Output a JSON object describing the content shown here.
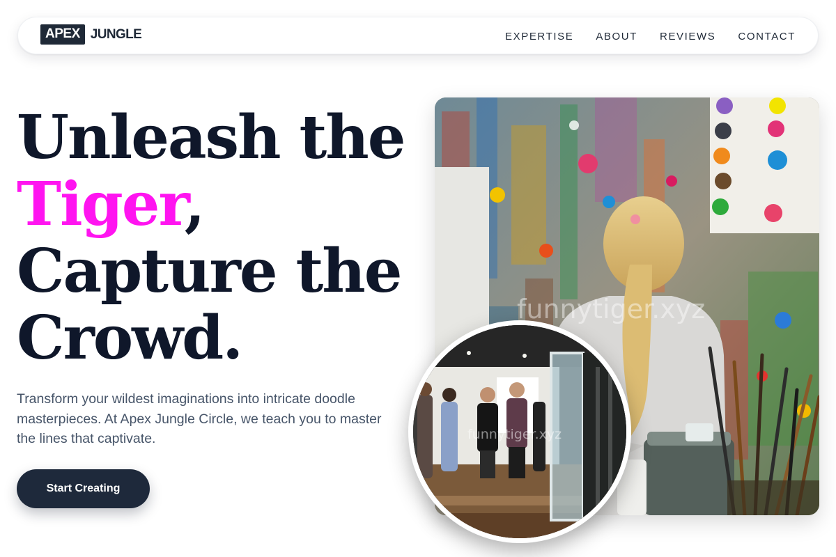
{
  "brand": {
    "box_text": "APEX",
    "word": "JUNGLE"
  },
  "nav": {
    "items": [
      {
        "label": "EXPERTISE"
      },
      {
        "label": "ABOUT"
      },
      {
        "label": "REVIEWS"
      },
      {
        "label": "CONTACT"
      }
    ]
  },
  "hero": {
    "headline_line1": "Unleash the",
    "headline_accent": "Tiger",
    "headline_comma": ",",
    "headline_line3": "Capture the",
    "headline_line4": "Crowd.",
    "subtitle": "Transform your wildest imaginations into intricate doodle masterpieces. At Apex Jungle Circle, we teach you to master the lines that captivate.",
    "cta_label": "Start Creating"
  },
  "images": {
    "main_watermark": "funnytiger.xyz",
    "round_watermark": "funnytiger.xyz"
  },
  "colors": {
    "accent": "#ff14f0",
    "navy": "#1e293b",
    "heading": "#0f172a",
    "body_text": "#475569"
  }
}
